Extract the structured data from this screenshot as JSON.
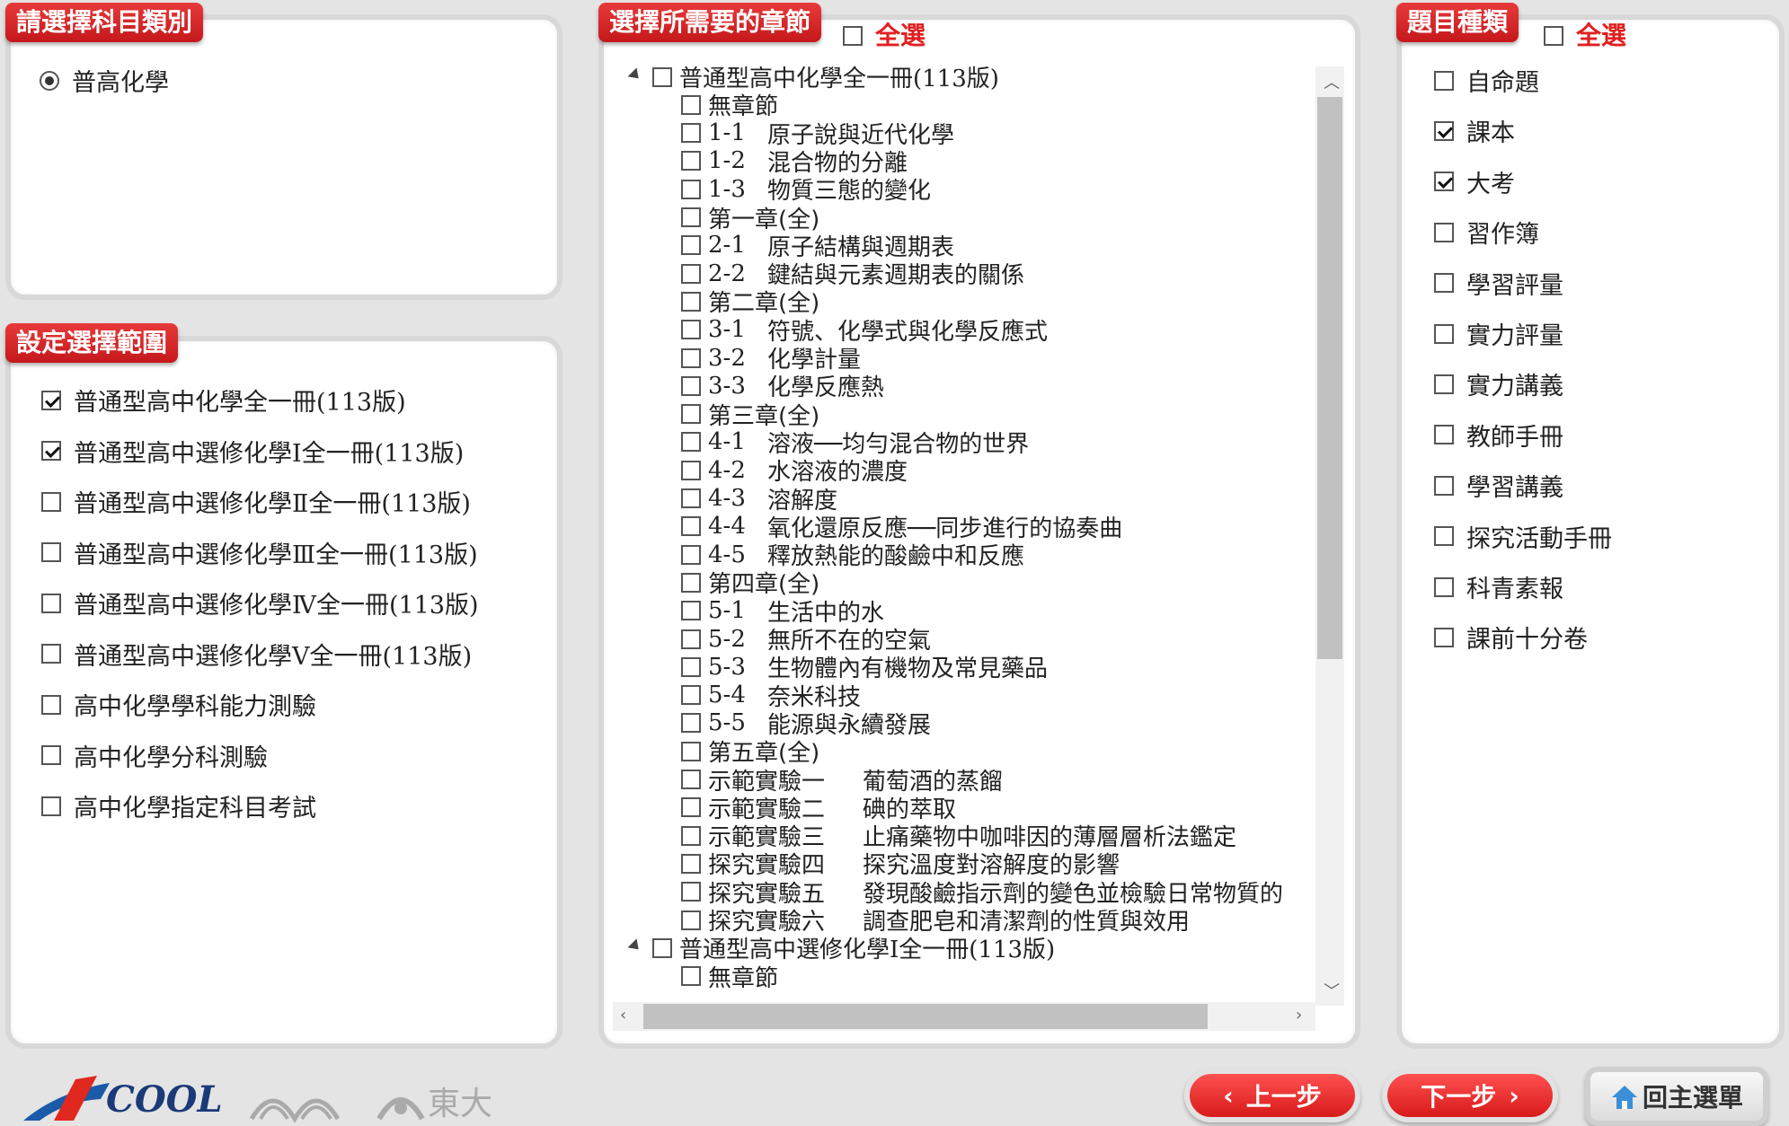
{
  "subject_panel": {
    "title": "請選擇科目類別",
    "options": [
      {
        "label": "普高化學",
        "selected": true
      }
    ]
  },
  "range_panel": {
    "title": "設定選擇範圍",
    "items": [
      {
        "label": "普通型高中化學全一冊(113版)",
        "checked": true
      },
      {
        "label": "普通型高中選修化學Ⅰ全一冊(113版)",
        "checked": true
      },
      {
        "label": "普通型高中選修化學Ⅱ全一冊(113版)",
        "checked": false
      },
      {
        "label": "普通型高中選修化學Ⅲ全一冊(113版)",
        "checked": false
      },
      {
        "label": "普通型高中選修化學Ⅳ全一冊(113版)",
        "checked": false
      },
      {
        "label": "普通型高中選修化學Ⅴ全一冊(113版)",
        "checked": false
      },
      {
        "label": "高中化學學科能力測驗",
        "checked": false
      },
      {
        "label": "高中化學分科測驗",
        "checked": false
      },
      {
        "label": "高中化學指定科目考試",
        "checked": false
      }
    ]
  },
  "chapter_panel": {
    "title": "選擇所需要的章節",
    "select_all": "全選",
    "tree": [
      {
        "level": 0,
        "label": "普通型高中化學全一冊(113版)"
      },
      {
        "level": 1,
        "code": "",
        "label": "無章節"
      },
      {
        "level": 1,
        "code": "1-1",
        "label": "原子說與近代化學"
      },
      {
        "level": 1,
        "code": "1-2",
        "label": "混合物的分離"
      },
      {
        "level": 1,
        "code": "1-3",
        "label": "物質三態的變化"
      },
      {
        "level": 1,
        "code": "",
        "label": "第一章(全)"
      },
      {
        "level": 1,
        "code": "2-1",
        "label": "原子結構與週期表"
      },
      {
        "level": 1,
        "code": "2-2",
        "label": "鍵結與元素週期表的關係"
      },
      {
        "level": 1,
        "code": "",
        "label": "第二章(全)"
      },
      {
        "level": 1,
        "code": "3-1",
        "label": "符號、化學式與化學反應式"
      },
      {
        "level": 1,
        "code": "3-2",
        "label": "化學計量"
      },
      {
        "level": 1,
        "code": "3-3",
        "label": "化學反應熱"
      },
      {
        "level": 1,
        "code": "",
        "label": "第三章(全)"
      },
      {
        "level": 1,
        "code": "4-1",
        "label": "溶液──均勻混合物的世界"
      },
      {
        "level": 1,
        "code": "4-2",
        "label": "水溶液的濃度"
      },
      {
        "level": 1,
        "code": "4-3",
        "label": "溶解度"
      },
      {
        "level": 1,
        "code": "4-4",
        "label": "氧化還原反應──同步進行的協奏曲"
      },
      {
        "level": 1,
        "code": "4-5",
        "label": "釋放熱能的酸鹼中和反應"
      },
      {
        "level": 1,
        "code": "",
        "label": "第四章(全)"
      },
      {
        "level": 1,
        "code": "5-1",
        "label": "生活中的水"
      },
      {
        "level": 1,
        "code": "5-2",
        "label": "無所不在的空氣"
      },
      {
        "level": 1,
        "code": "5-3",
        "label": "生物體內有機物及常見藥品"
      },
      {
        "level": 1,
        "code": "5-4",
        "label": "奈米科技"
      },
      {
        "level": 1,
        "code": "5-5",
        "label": "能源與永續發展"
      },
      {
        "level": 1,
        "code": "",
        "label": "第五章(全)"
      },
      {
        "level": 1,
        "code": "示範實驗一",
        "label": "葡萄酒的蒸餾"
      },
      {
        "level": 1,
        "code": "示範實驗二",
        "label": "碘的萃取"
      },
      {
        "level": 1,
        "code": "示範實驗三",
        "label": "止痛藥物中咖啡因的薄層層析法鑑定"
      },
      {
        "level": 1,
        "code": "探究實驗四",
        "label": "探究溫度對溶解度的影響"
      },
      {
        "level": 1,
        "code": "探究實驗五",
        "label": "發現酸鹼指示劑的變色並檢驗日常物質的"
      },
      {
        "level": 1,
        "code": "探究實驗六",
        "label": "調查肥皂和清潔劑的性質與效用"
      },
      {
        "level": 0,
        "label": "普通型高中選修化學Ⅰ全一冊(113版)"
      },
      {
        "level": 1,
        "code": "",
        "label": "無章節"
      }
    ]
  },
  "type_panel": {
    "title": "題目種類",
    "select_all": "全選",
    "items": [
      {
        "label": "自命題",
        "checked": false
      },
      {
        "label": "課本",
        "checked": true
      },
      {
        "label": "大考",
        "checked": true
      },
      {
        "label": "習作簿",
        "checked": false
      },
      {
        "label": "學習評量",
        "checked": false
      },
      {
        "label": "實力評量",
        "checked": false
      },
      {
        "label": "實力講義",
        "checked": false
      },
      {
        "label": "教師手冊",
        "checked": false
      },
      {
        "label": "學習講義",
        "checked": false
      },
      {
        "label": "探究活動手冊",
        "checked": false
      },
      {
        "label": "科青素報",
        "checked": false
      },
      {
        "label": "課前十分卷",
        "checked": false
      }
    ]
  },
  "footer": {
    "logo_text": "COOL",
    "publisher_text": "東大",
    "prev_button": "上一步",
    "next_button": "下一步",
    "home_button": "回主選單"
  },
  "colors": {
    "accent": "#d81a1a",
    "panel_border": "#d8d8d8",
    "background": "#e4e4e4"
  }
}
